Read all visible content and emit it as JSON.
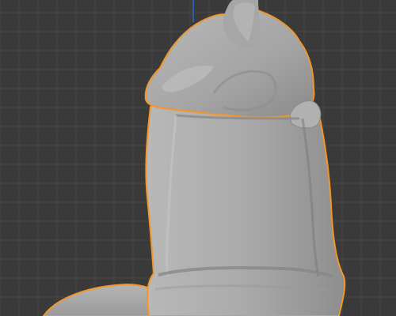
{
  "app": {
    "name": "3D viewport",
    "mode": "object-selected",
    "background_color": "#3a3a3a",
    "grid_color": "#484848",
    "axis_color": "#2a5fa8"
  },
  "selection": {
    "outline_color": "#f0962a",
    "object_color": "#a9a9a9",
    "object_label": ""
  },
  "icons": [
    "sculpt-model-icon",
    "selection-outline-icon"
  ]
}
